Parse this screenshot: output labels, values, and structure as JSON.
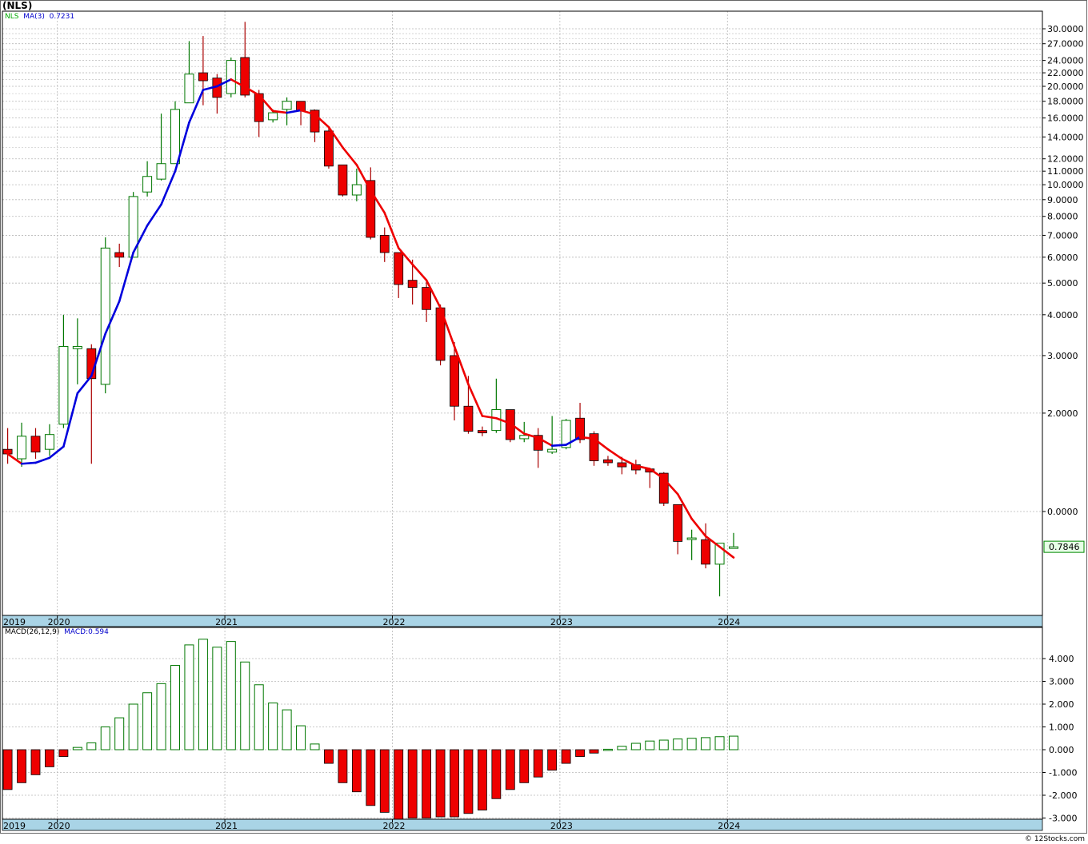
{
  "header": {
    "symbol_title": "(NLS)",
    "legend_symbol": "NLS",
    "legend_ma_label": "MA(3)",
    "legend_ma_value": "0.7231",
    "last_price_label": "0.7846",
    "macd_label": "MACD(26,12,9)",
    "macd_value_label": "MACD:0.594",
    "credit": "© 12Stocks.com"
  },
  "colors": {
    "up": "#007700",
    "down": "#ee0000",
    "ma_up": "#0000dd",
    "ma_down": "#ee0000",
    "grid": "#b8b8b8",
    "axis_band": "#a9d4e6",
    "price_tag_bg": "#e6ffe6"
  },
  "chart_data": [
    {
      "type": "candlestick",
      "scale": "log",
      "price_tick_labels": [
        "30.0000",
        "27.0000",
        "24.0000",
        "22.0000",
        "20.0000",
        "18.0000",
        "16.0000",
        "14.0000",
        "12.0000",
        "11.0000",
        "10.0000",
        "9.0000",
        "8.0000",
        "7.0000",
        "6.0000",
        "5.0000",
        "4.0000",
        "3.0000",
        "2.0000",
        "0.0000"
      ],
      "price_tick_values": [
        30,
        27,
        24,
        22,
        20,
        18,
        16,
        14,
        12,
        11,
        10,
        9,
        8,
        7,
        6,
        5,
        4,
        3,
        2,
        1
      ],
      "minor_grid_values": [
        29,
        28,
        26,
        25,
        23,
        21,
        19,
        17,
        15,
        13
      ],
      "year_labels": [
        "2019",
        "2020",
        "2021",
        "2022",
        "2023",
        "2024"
      ],
      "year_month_index": [
        0,
        4,
        16,
        28,
        40,
        52
      ],
      "ylim": [
        0.55,
        36
      ],
      "candles": [
        {
          "o": 1.55,
          "h": 1.8,
          "l": 1.4,
          "c": 1.5
        },
        {
          "o": 1.45,
          "h": 1.87,
          "l": 1.37,
          "c": 1.7
        },
        {
          "o": 1.7,
          "h": 1.8,
          "l": 1.45,
          "c": 1.52
        },
        {
          "o": 1.55,
          "h": 1.85,
          "l": 1.48,
          "c": 1.72
        },
        {
          "o": 1.85,
          "h": 4.0,
          "l": 1.8,
          "c": 3.2
        },
        {
          "o": 3.15,
          "h": 3.9,
          "l": 2.45,
          "c": 3.2
        },
        {
          "o": 3.15,
          "h": 3.25,
          "l": 1.4,
          "c": 2.55
        },
        {
          "o": 2.45,
          "h": 6.9,
          "l": 2.3,
          "c": 6.4
        },
        {
          "o": 6.2,
          "h": 6.6,
          "l": 5.6,
          "c": 6.0
        },
        {
          "o": 6.0,
          "h": 9.5,
          "l": 6.0,
          "c": 9.2
        },
        {
          "o": 9.5,
          "h": 11.8,
          "l": 9.2,
          "c": 10.6
        },
        {
          "o": 10.4,
          "h": 16.5,
          "l": 10.3,
          "c": 11.6
        },
        {
          "o": 11.6,
          "h": 18.0,
          "l": 11.6,
          "c": 17.0
        },
        {
          "o": 17.8,
          "h": 27.5,
          "l": 17.8,
          "c": 21.8
        },
        {
          "o": 22.0,
          "h": 28.5,
          "l": 17.5,
          "c": 20.8
        },
        {
          "o": 21.2,
          "h": 21.8,
          "l": 16.5,
          "c": 18.5
        },
        {
          "o": 19.0,
          "h": 24.5,
          "l": 18.5,
          "c": 24.0
        },
        {
          "o": 24.5,
          "h": 31.5,
          "l": 18.5,
          "c": 18.8
        },
        {
          "o": 19.0,
          "h": 19.5,
          "l": 14.0,
          "c": 15.6
        },
        {
          "o": 15.8,
          "h": 17.0,
          "l": 15.5,
          "c": 16.6
        },
        {
          "o": 17.0,
          "h": 18.5,
          "l": 15.2,
          "c": 18.0
        },
        {
          "o": 18.0,
          "h": 18.0,
          "l": 15.2,
          "c": 16.8
        },
        {
          "o": 16.9,
          "h": 17.0,
          "l": 13.5,
          "c": 14.5
        },
        {
          "o": 14.6,
          "h": 15.0,
          "l": 11.2,
          "c": 11.4
        },
        {
          "o": 11.5,
          "h": 11.5,
          "l": 9.2,
          "c": 9.3
        },
        {
          "o": 9.3,
          "h": 11.2,
          "l": 8.9,
          "c": 10.0
        },
        {
          "o": 10.3,
          "h": 11.3,
          "l": 6.8,
          "c": 6.9
        },
        {
          "o": 7.0,
          "h": 7.4,
          "l": 5.8,
          "c": 6.2
        },
        {
          "o": 6.2,
          "h": 6.2,
          "l": 4.5,
          "c": 4.95
        },
        {
          "o": 5.1,
          "h": 5.9,
          "l": 4.3,
          "c": 4.85
        },
        {
          "o": 4.85,
          "h": 5.1,
          "l": 3.8,
          "c": 4.15
        },
        {
          "o": 4.2,
          "h": 4.3,
          "l": 2.8,
          "c": 2.9
        },
        {
          "o": 3.0,
          "h": 3.3,
          "l": 1.9,
          "c": 2.1
        },
        {
          "o": 2.1,
          "h": 2.6,
          "l": 1.73,
          "c": 1.76
        },
        {
          "o": 1.77,
          "h": 1.82,
          "l": 1.7,
          "c": 1.74
        },
        {
          "o": 1.77,
          "h": 2.55,
          "l": 1.74,
          "c": 2.05
        },
        {
          "o": 2.05,
          "h": 2.05,
          "l": 1.63,
          "c": 1.66
        },
        {
          "o": 1.67,
          "h": 1.88,
          "l": 1.63,
          "c": 1.71
        },
        {
          "o": 1.71,
          "h": 1.8,
          "l": 1.36,
          "c": 1.54
        },
        {
          "o": 1.52,
          "h": 1.96,
          "l": 1.5,
          "c": 1.55
        },
        {
          "o": 1.57,
          "h": 1.92,
          "l": 1.55,
          "c": 1.9
        },
        {
          "o": 1.93,
          "h": 2.15,
          "l": 1.62,
          "c": 1.66
        },
        {
          "o": 1.73,
          "h": 1.76,
          "l": 1.38,
          "c": 1.43
        },
        {
          "o": 1.44,
          "h": 1.48,
          "l": 1.38,
          "c": 1.41
        },
        {
          "o": 1.41,
          "h": 1.47,
          "l": 1.3,
          "c": 1.37
        },
        {
          "o": 1.39,
          "h": 1.44,
          "l": 1.3,
          "c": 1.34
        },
        {
          "o": 1.35,
          "h": 1.36,
          "l": 1.18,
          "c": 1.32
        },
        {
          "o": 1.31,
          "h": 1.32,
          "l": 1.04,
          "c": 1.06
        },
        {
          "o": 1.05,
          "h": 1.05,
          "l": 0.74,
          "c": 0.81
        },
        {
          "o": 0.83,
          "h": 0.88,
          "l": 0.71,
          "c": 0.83
        },
        {
          "o": 0.82,
          "h": 0.92,
          "l": 0.67,
          "c": 0.69
        },
        {
          "o": 0.69,
          "h": 0.79,
          "l": 0.55,
          "c": 0.8
        },
        {
          "o": 0.78,
          "h": 0.86,
          "l": 0.77,
          "c": 0.78
        }
      ],
      "ma": [
        1.5,
        1.4,
        1.41,
        1.46,
        1.58,
        2.3,
        2.6,
        3.5,
        4.4,
        6.2,
        7.5,
        8.7,
        11.0,
        15.5,
        19.5,
        20.0,
        21.0,
        19.9,
        18.8,
        16.8,
        16.6,
        16.9,
        16.4,
        15.0,
        13.0,
        11.5,
        9.6,
        8.2,
        6.4,
        5.7,
        5.1,
        4.2,
        3.2,
        2.45,
        1.96,
        1.93,
        1.86,
        1.73,
        1.68,
        1.59,
        1.6,
        1.69,
        1.67,
        1.55,
        1.45,
        1.38,
        1.35,
        1.26,
        1.13,
        0.95,
        0.84,
        0.78,
        0.7231
      ]
    },
    {
      "type": "bar",
      "name": "MACD(26,12,9)",
      "tick_labels": [
        "4.000",
        "3.000",
        "2.000",
        "1.000",
        "0.000",
        "-1.000",
        "-2.000",
        "-3.000"
      ],
      "tick_values": [
        4,
        3,
        2,
        1,
        0,
        -1,
        -2,
        -3
      ],
      "ylim": [
        -3.3,
        4.95
      ],
      "values": [
        -1.75,
        -1.45,
        -1.1,
        -0.75,
        -0.3,
        0.1,
        0.3,
        1.0,
        1.4,
        2.0,
        2.5,
        2.9,
        3.7,
        4.6,
        4.85,
        4.5,
        4.75,
        3.85,
        2.85,
        2.05,
        1.75,
        1.05,
        0.25,
        -0.6,
        -1.45,
        -1.85,
        -2.45,
        -2.75,
        -3.05,
        -3.0,
        -3.0,
        -2.95,
        -2.95,
        -2.8,
        -2.65,
        -2.15,
        -1.75,
        -1.45,
        -1.2,
        -0.9,
        -0.6,
        -0.3,
        -0.15,
        0.02,
        0.15,
        0.28,
        0.38,
        0.42,
        0.47,
        0.5,
        0.53,
        0.57,
        0.594
      ]
    }
  ]
}
